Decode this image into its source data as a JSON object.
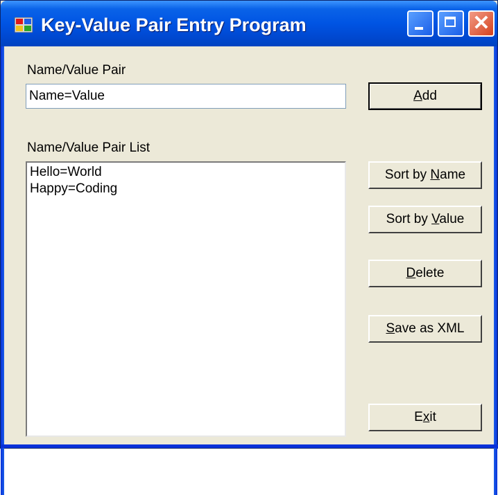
{
  "window": {
    "title": "Key-Value Pair Entry Program",
    "icon": "app-window-icon",
    "controls": [
      "minimize-icon",
      "maximize-icon",
      "close-icon"
    ]
  },
  "form": {
    "pair_label": "Name/Value Pair",
    "pair_input_value": "Name=Value",
    "list_label": "Name/Value Pair List",
    "list_items": [
      "Hello=World",
      "Happy=Coding"
    ]
  },
  "buttons": {
    "add": {
      "pre": "",
      "key": "A",
      "post": "dd"
    },
    "sort_name": {
      "pre": "Sort by ",
      "key": "N",
      "post": "ame"
    },
    "sort_value": {
      "pre": "Sort by ",
      "key": "V",
      "post": "alue"
    },
    "delete": {
      "pre": "",
      "key": "D",
      "post": "elete"
    },
    "save_xml": {
      "pre": "",
      "key": "S",
      "post": "ave as XML"
    },
    "exit": {
      "pre": "E",
      "key": "x",
      "post": "it"
    }
  },
  "colors": {
    "titlebar": "#0054e3",
    "face": "#ece9d8",
    "close": "#d4411e"
  }
}
